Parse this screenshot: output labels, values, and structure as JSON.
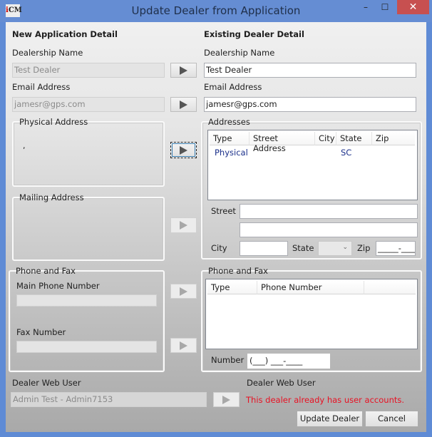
{
  "window": {
    "title": "Update Dealer from Application",
    "logo_text": "CM",
    "minimize": "–",
    "maximize": "☐",
    "close": "✕"
  },
  "left": {
    "header": "New Application Detail",
    "dealership_name_label": "Dealership Name",
    "dealership_name_value": "Test Dealer",
    "email_label": "Email Address",
    "email_value": "jamesr@gps.com",
    "physical_address_label": "Physical Address",
    "physical_address_value": ",",
    "mailing_address_label": "Mailing Address",
    "mailing_address_value": "",
    "phone_fax_label": "Phone and Fax",
    "main_phone_label": "Main Phone Number",
    "main_phone_value": "",
    "fax_label": "Fax Number",
    "fax_value": "",
    "web_user_label": "Dealer Web User",
    "web_user_value": "Admin  Test  - Admin7153"
  },
  "right": {
    "header": "Existing Dealer Detail",
    "dealership_name_label": "Dealership Name",
    "dealership_name_value": "Test Dealer",
    "email_label": "Email Address",
    "email_value": "jamesr@gps.com",
    "addresses": {
      "label": "Addresses",
      "columns": [
        "Type",
        "Street Address",
        "City",
        "State",
        "Zip"
      ],
      "rows": [
        {
          "type": "Physical",
          "street": "",
          "city": "",
          "state": "SC",
          "zip": ""
        }
      ],
      "street_label": "Street",
      "street1": "",
      "street2": "",
      "city_label": "City",
      "city": "",
      "state_label": "State",
      "state": "",
      "zip_label": "Zip",
      "zip": "_____-____"
    },
    "phone": {
      "label": "Phone and Fax",
      "columns": [
        "Type",
        "Phone Number",
        ""
      ],
      "rows": [],
      "number_label": "Number",
      "number": "(___) ___-____"
    },
    "web_user_label": "Dealer Web User",
    "web_user_message": "This dealer already has user accounts."
  },
  "buttons": {
    "update": "Update Dealer",
    "cancel": "Cancel"
  },
  "colors": {
    "titlebar": "#658dd3",
    "close": "#c75050",
    "error": "#e81123",
    "link_row": "#1a2f8a"
  }
}
